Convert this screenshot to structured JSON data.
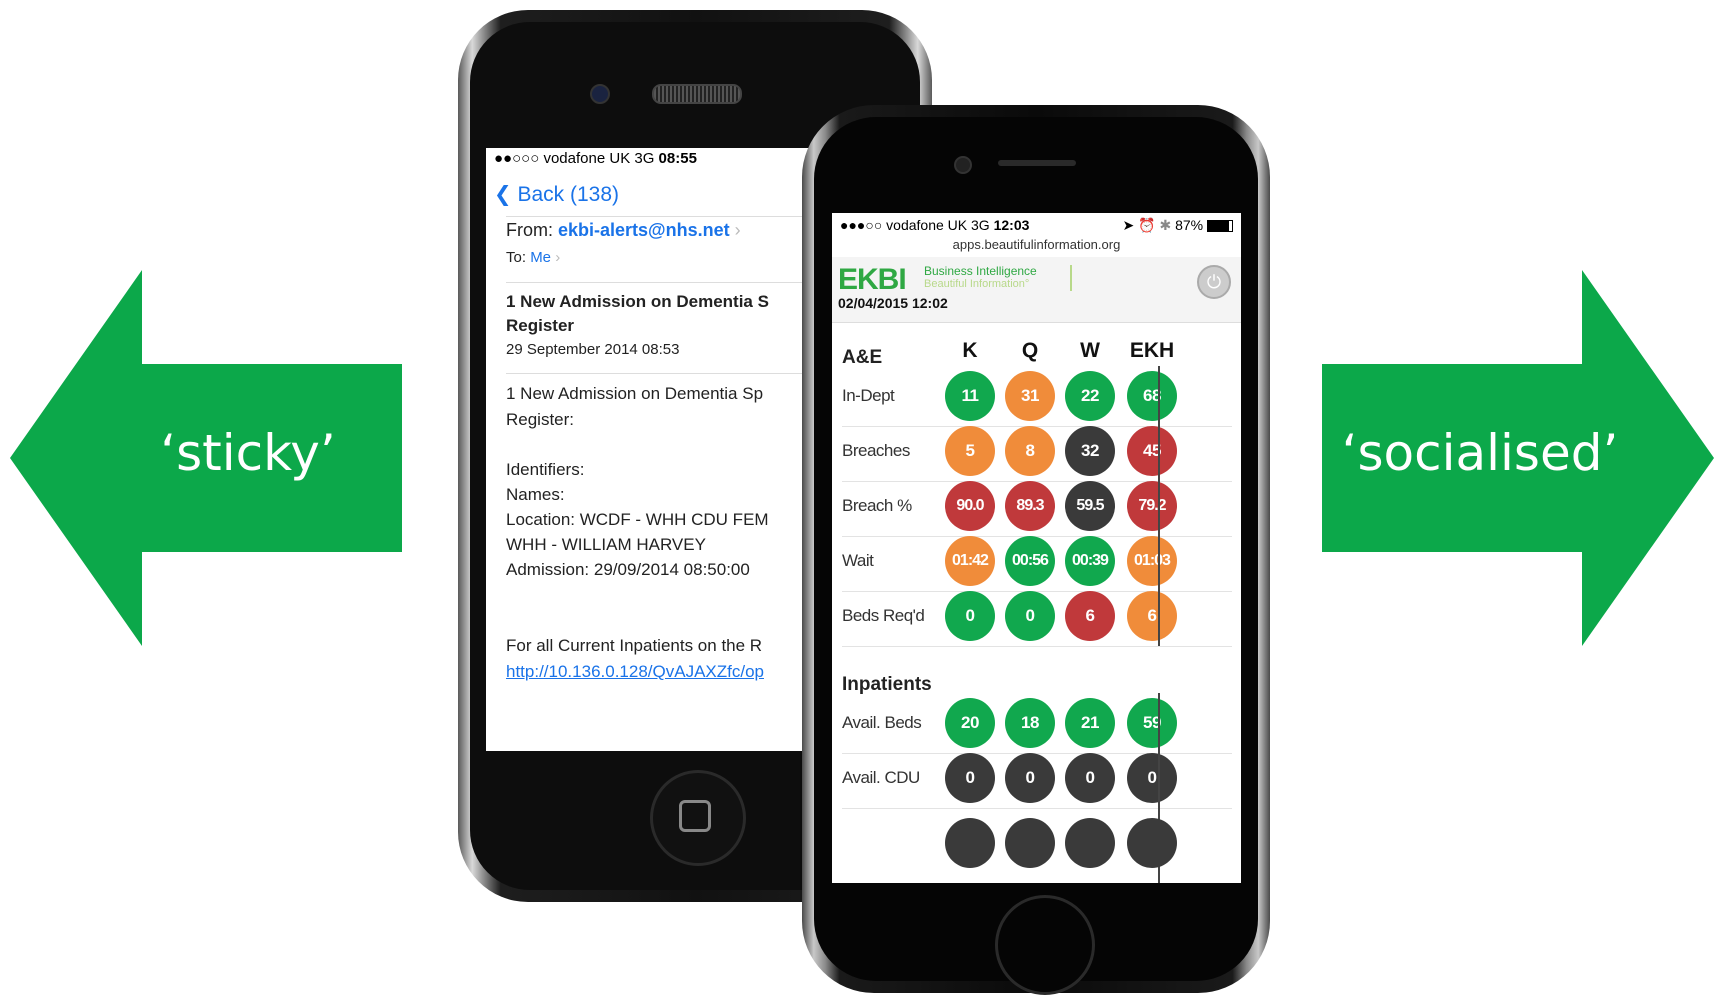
{
  "labels": {
    "left": "‘sticky’",
    "right": "‘socialised’"
  },
  "colors": {
    "arrow_green": "#0ca84a",
    "green": "#11a84e",
    "orange": "#f08c3a",
    "red": "#c0393b",
    "dark": "#3a3a3a",
    "link_blue": "#1a73e8"
  },
  "email_phone": {
    "status_carrier": "●●○○○ vodafone UK  3G",
    "status_time": "08:55",
    "back_label": "Back (138)",
    "from_label": "From:",
    "from_value": "ekbi-alerts@nhs.net",
    "to_label": "To:",
    "to_value": "Me",
    "subject_line1": "1 New Admission on Dementia S",
    "subject_line2": "Register",
    "date": "29 September 2014 08:53",
    "body_line1": "1 New Admission on Dementia Sp",
    "body_line2": "Register:",
    "identifiers": "Identifiers:",
    "names": "Names:",
    "location": "Location: WCDF - WHH CDU FEM",
    "location2": "WHH - WILLIAM HARVEY",
    "admission": "Admission: 29/09/2014 08:50:00",
    "footer": "For all Current Inpatients on the R",
    "link": "http://10.136.0.128/QvAJAXZfc/op"
  },
  "dashboard_phone": {
    "status_carrier": "●●●○○ vodafone UK  3G",
    "status_time": "12:03",
    "status_battery": "87%",
    "url": "apps.beautifulinformation.org",
    "logo": "EKBI",
    "tagline1": "Business Intelligence",
    "tagline2": "Beautiful Information°",
    "datetime": "02/04/2015 12:02",
    "columns": [
      "K",
      "Q",
      "W",
      "EKH"
    ],
    "sections": [
      {
        "title": "A&E",
        "rows": [
          {
            "label": "In-Dept",
            "values": [
              "11",
              "31",
              "22",
              "68"
            ],
            "colors": [
              "green",
              "orange",
              "green",
              "green"
            ]
          },
          {
            "label": "Breaches",
            "values": [
              "5",
              "8",
              "32",
              "45"
            ],
            "colors": [
              "orange",
              "orange",
              "dark",
              "red"
            ]
          },
          {
            "label": "Breach %",
            "values": [
              "90.0",
              "89.3",
              "59.5",
              "79.2"
            ],
            "colors": [
              "red",
              "red",
              "dark",
              "red"
            ]
          },
          {
            "label": "Wait",
            "values": [
              "01:42",
              "00:56",
              "00:39",
              "01:03"
            ],
            "colors": [
              "orange",
              "green",
              "green",
              "orange"
            ]
          },
          {
            "label": "Beds Req'd",
            "values": [
              "0",
              "0",
              "6",
              "6"
            ],
            "colors": [
              "green",
              "green",
              "red",
              "orange"
            ]
          }
        ]
      },
      {
        "title": "Inpatients",
        "rows": [
          {
            "label": "Avail. Beds",
            "values": [
              "20",
              "18",
              "21",
              "59"
            ],
            "colors": [
              "green",
              "green",
              "green",
              "green"
            ]
          },
          {
            "label": "Avail. CDU",
            "values": [
              "0",
              "0",
              "0",
              "0"
            ],
            "colors": [
              "dark",
              "dark",
              "dark",
              "dark"
            ]
          }
        ]
      }
    ]
  }
}
